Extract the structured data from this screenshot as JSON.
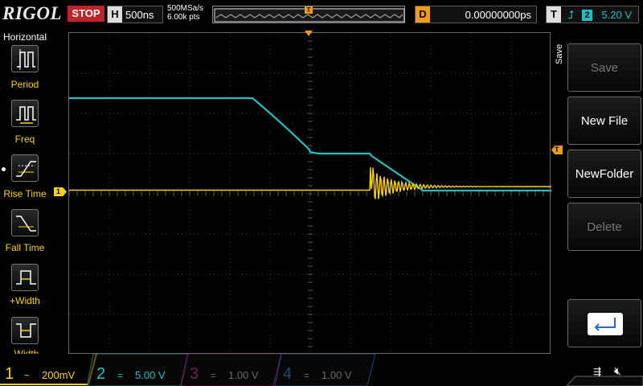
{
  "topbar": {
    "logo": "RIGOL",
    "run_status": "STOP",
    "horizontal_label": "H",
    "timebase": "500ns",
    "sample_rate": "500MSa/s",
    "memory_depth": "6.00k pts",
    "trigger_pos_marker": "T",
    "delay_label": "D",
    "delay_value": "0.00000000ps",
    "trigger_label": "T",
    "trigger_edge_icon": "rising-edge-icon",
    "trigger_source": "2",
    "trigger_level": "5.20 V"
  },
  "left_panel": {
    "title": "Horizontal",
    "items": [
      {
        "label": "Period",
        "icon": "period-icon"
      },
      {
        "label": "Freq",
        "icon": "frequency-icon"
      },
      {
        "label": "Rise Time",
        "icon": "rise-time-icon"
      },
      {
        "label": "Fall Time",
        "icon": "fall-time-icon"
      },
      {
        "label": "+Width",
        "icon": "positive-width-icon"
      },
      {
        "label": "-Width",
        "icon": "negative-width-icon"
      }
    ]
  },
  "right_menu": {
    "title": "Save",
    "buttons": [
      {
        "label": "Save",
        "enabled": false
      },
      {
        "label": "New File",
        "enabled": true
      },
      {
        "label": "NewFolder",
        "enabled": true
      },
      {
        "label": "Delete",
        "enabled": false
      },
      {
        "label": "",
        "icon": "return-arrow-icon",
        "enabled": true
      }
    ]
  },
  "markers": {
    "ch1_ground": "1",
    "trigger_level_marker": "T"
  },
  "channels": [
    {
      "num": "1",
      "coupling": "~",
      "scale": "200mV",
      "color": "#ffd200",
      "active": true
    },
    {
      "num": "2",
      "coupling": "=",
      "scale": "5.00 V",
      "color": "#1fc0c4",
      "active": false
    },
    {
      "num": "3",
      "coupling": "=",
      "scale": "1.00 V",
      "color": "#c2188c",
      "active": false
    },
    {
      "num": "4",
      "coupling": "=",
      "scale": "1.00 V",
      "color": "#2f6ed8",
      "active": false
    }
  ],
  "status_icons": {
    "usb": "usb-icon",
    "sound": "speaker-muted-icon"
  },
  "colors": {
    "ch1": "#ffd200",
    "ch2": "#1fc0c4",
    "trigger": "#f29a12",
    "stop": "#c0242a"
  }
}
